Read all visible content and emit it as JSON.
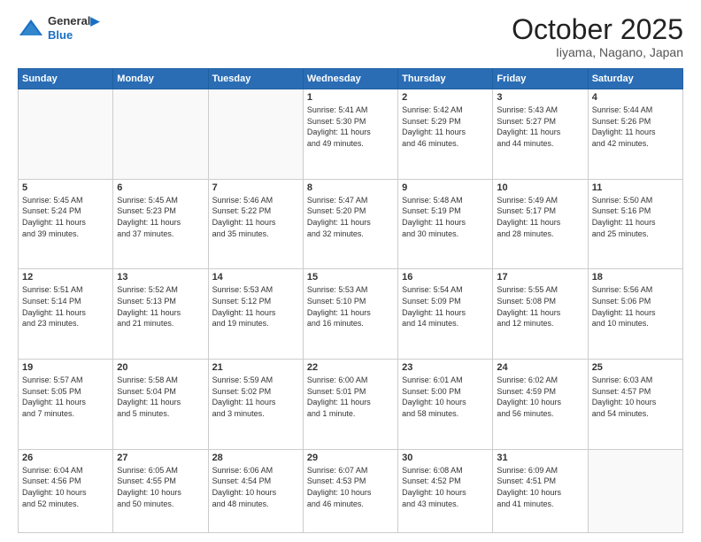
{
  "header": {
    "logo_line1": "General",
    "logo_line2": "Blue",
    "month": "October 2025",
    "location": "Iiyama, Nagano, Japan"
  },
  "weekdays": [
    "Sunday",
    "Monday",
    "Tuesday",
    "Wednesday",
    "Thursday",
    "Friday",
    "Saturday"
  ],
  "weeks": [
    [
      {
        "day": "",
        "text": ""
      },
      {
        "day": "",
        "text": ""
      },
      {
        "day": "",
        "text": ""
      },
      {
        "day": "1",
        "text": "Sunrise: 5:41 AM\nSunset: 5:30 PM\nDaylight: 11 hours\nand 49 minutes."
      },
      {
        "day": "2",
        "text": "Sunrise: 5:42 AM\nSunset: 5:29 PM\nDaylight: 11 hours\nand 46 minutes."
      },
      {
        "day": "3",
        "text": "Sunrise: 5:43 AM\nSunset: 5:27 PM\nDaylight: 11 hours\nand 44 minutes."
      },
      {
        "day": "4",
        "text": "Sunrise: 5:44 AM\nSunset: 5:26 PM\nDaylight: 11 hours\nand 42 minutes."
      }
    ],
    [
      {
        "day": "5",
        "text": "Sunrise: 5:45 AM\nSunset: 5:24 PM\nDaylight: 11 hours\nand 39 minutes."
      },
      {
        "day": "6",
        "text": "Sunrise: 5:45 AM\nSunset: 5:23 PM\nDaylight: 11 hours\nand 37 minutes."
      },
      {
        "day": "7",
        "text": "Sunrise: 5:46 AM\nSunset: 5:22 PM\nDaylight: 11 hours\nand 35 minutes."
      },
      {
        "day": "8",
        "text": "Sunrise: 5:47 AM\nSunset: 5:20 PM\nDaylight: 11 hours\nand 32 minutes."
      },
      {
        "day": "9",
        "text": "Sunrise: 5:48 AM\nSunset: 5:19 PM\nDaylight: 11 hours\nand 30 minutes."
      },
      {
        "day": "10",
        "text": "Sunrise: 5:49 AM\nSunset: 5:17 PM\nDaylight: 11 hours\nand 28 minutes."
      },
      {
        "day": "11",
        "text": "Sunrise: 5:50 AM\nSunset: 5:16 PM\nDaylight: 11 hours\nand 25 minutes."
      }
    ],
    [
      {
        "day": "12",
        "text": "Sunrise: 5:51 AM\nSunset: 5:14 PM\nDaylight: 11 hours\nand 23 minutes."
      },
      {
        "day": "13",
        "text": "Sunrise: 5:52 AM\nSunset: 5:13 PM\nDaylight: 11 hours\nand 21 minutes."
      },
      {
        "day": "14",
        "text": "Sunrise: 5:53 AM\nSunset: 5:12 PM\nDaylight: 11 hours\nand 19 minutes."
      },
      {
        "day": "15",
        "text": "Sunrise: 5:53 AM\nSunset: 5:10 PM\nDaylight: 11 hours\nand 16 minutes."
      },
      {
        "day": "16",
        "text": "Sunrise: 5:54 AM\nSunset: 5:09 PM\nDaylight: 11 hours\nand 14 minutes."
      },
      {
        "day": "17",
        "text": "Sunrise: 5:55 AM\nSunset: 5:08 PM\nDaylight: 11 hours\nand 12 minutes."
      },
      {
        "day": "18",
        "text": "Sunrise: 5:56 AM\nSunset: 5:06 PM\nDaylight: 11 hours\nand 10 minutes."
      }
    ],
    [
      {
        "day": "19",
        "text": "Sunrise: 5:57 AM\nSunset: 5:05 PM\nDaylight: 11 hours\nand 7 minutes."
      },
      {
        "day": "20",
        "text": "Sunrise: 5:58 AM\nSunset: 5:04 PM\nDaylight: 11 hours\nand 5 minutes."
      },
      {
        "day": "21",
        "text": "Sunrise: 5:59 AM\nSunset: 5:02 PM\nDaylight: 11 hours\nand 3 minutes."
      },
      {
        "day": "22",
        "text": "Sunrise: 6:00 AM\nSunset: 5:01 PM\nDaylight: 11 hours\nand 1 minute."
      },
      {
        "day": "23",
        "text": "Sunrise: 6:01 AM\nSunset: 5:00 PM\nDaylight: 10 hours\nand 58 minutes."
      },
      {
        "day": "24",
        "text": "Sunrise: 6:02 AM\nSunset: 4:59 PM\nDaylight: 10 hours\nand 56 minutes."
      },
      {
        "day": "25",
        "text": "Sunrise: 6:03 AM\nSunset: 4:57 PM\nDaylight: 10 hours\nand 54 minutes."
      }
    ],
    [
      {
        "day": "26",
        "text": "Sunrise: 6:04 AM\nSunset: 4:56 PM\nDaylight: 10 hours\nand 52 minutes."
      },
      {
        "day": "27",
        "text": "Sunrise: 6:05 AM\nSunset: 4:55 PM\nDaylight: 10 hours\nand 50 minutes."
      },
      {
        "day": "28",
        "text": "Sunrise: 6:06 AM\nSunset: 4:54 PM\nDaylight: 10 hours\nand 48 minutes."
      },
      {
        "day": "29",
        "text": "Sunrise: 6:07 AM\nSunset: 4:53 PM\nDaylight: 10 hours\nand 46 minutes."
      },
      {
        "day": "30",
        "text": "Sunrise: 6:08 AM\nSunset: 4:52 PM\nDaylight: 10 hours\nand 43 minutes."
      },
      {
        "day": "31",
        "text": "Sunrise: 6:09 AM\nSunset: 4:51 PM\nDaylight: 10 hours\nand 41 minutes."
      },
      {
        "day": "",
        "text": ""
      }
    ]
  ]
}
